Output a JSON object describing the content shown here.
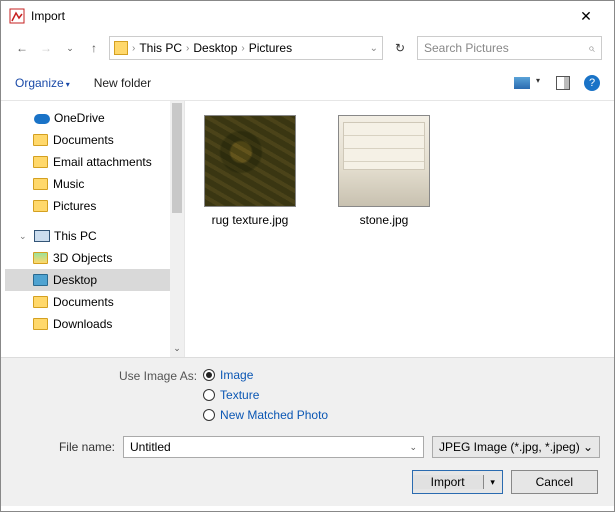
{
  "window": {
    "title": "Import"
  },
  "nav": {
    "crumbs": [
      "This PC",
      "Desktop",
      "Pictures"
    ],
    "search_placeholder": "Search Pictures"
  },
  "toolbar": {
    "organize": "Organize",
    "new_folder": "New folder",
    "help_glyph": "?"
  },
  "tree": {
    "onedrive": "OneDrive",
    "onedrive_items": [
      "Documents",
      "Email attachments",
      "Music",
      "Pictures"
    ],
    "thispc": "This PC",
    "thispc_items": [
      "3D Objects",
      "Desktop",
      "Documents",
      "Downloads"
    ]
  },
  "files": [
    {
      "name": "rug texture.jpg"
    },
    {
      "name": "stone.jpg"
    }
  ],
  "use_image_as": {
    "label": "Use Image As:",
    "options": [
      "Image",
      "Texture",
      "New Matched Photo"
    ],
    "selected": 0
  },
  "filename": {
    "label": "File name:",
    "value": "Untitled",
    "filter": "JPEG Image (*.jpg, *.jpeg)"
  },
  "buttons": {
    "import": "Import",
    "cancel": "Cancel"
  }
}
